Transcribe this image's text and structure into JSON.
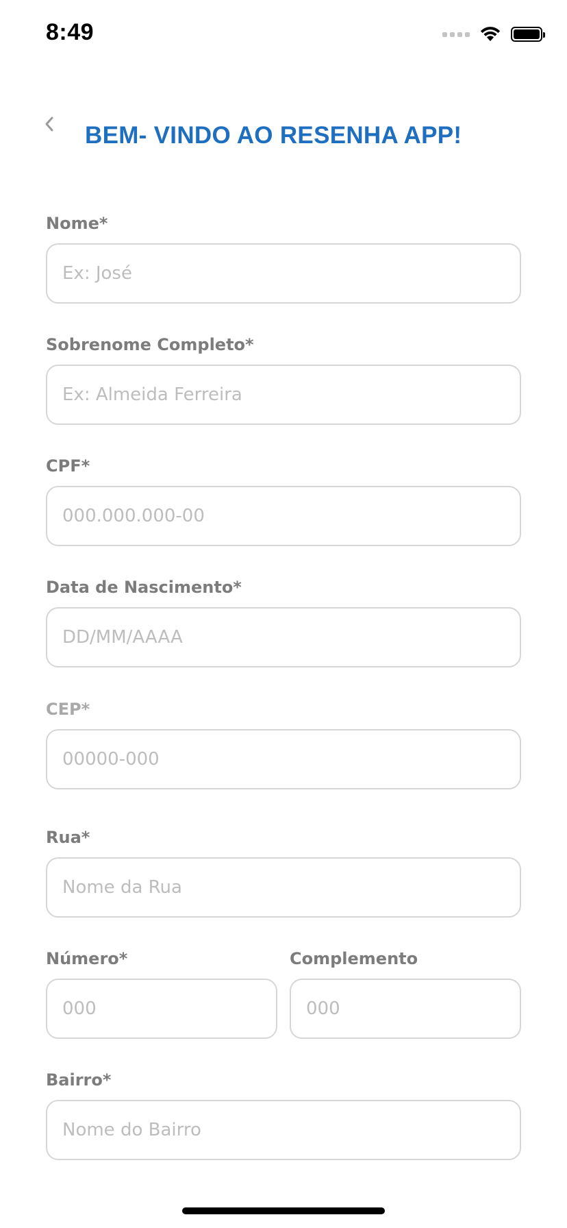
{
  "status_bar": {
    "time": "8:49"
  },
  "header": {
    "title": "BEM- VINDO AO RESENHA APP!",
    "accent_color": "#1e6fbf",
    "back_icon": "chevron-left-icon"
  },
  "form": {
    "nome": {
      "label": "Nome*",
      "placeholder": "Ex: José"
    },
    "sobrenome": {
      "label": "Sobrenome Completo*",
      "placeholder": "Ex: Almeida Ferreira"
    },
    "cpf": {
      "label": "CPF*",
      "placeholder": "000.000.000-00"
    },
    "nascimento": {
      "label": "Data de Nascimento*",
      "placeholder": "DD/MM/AAAA"
    },
    "cep": {
      "label": "CEP*",
      "placeholder": "00000-000"
    },
    "rua": {
      "label": "Rua*",
      "placeholder": "Nome da Rua"
    },
    "numero": {
      "label": "Número*",
      "placeholder": "000"
    },
    "complemento": {
      "label": "Complemento",
      "placeholder": "000"
    },
    "bairro": {
      "label": "Bairro*",
      "placeholder": "Nome do Bairro"
    }
  }
}
